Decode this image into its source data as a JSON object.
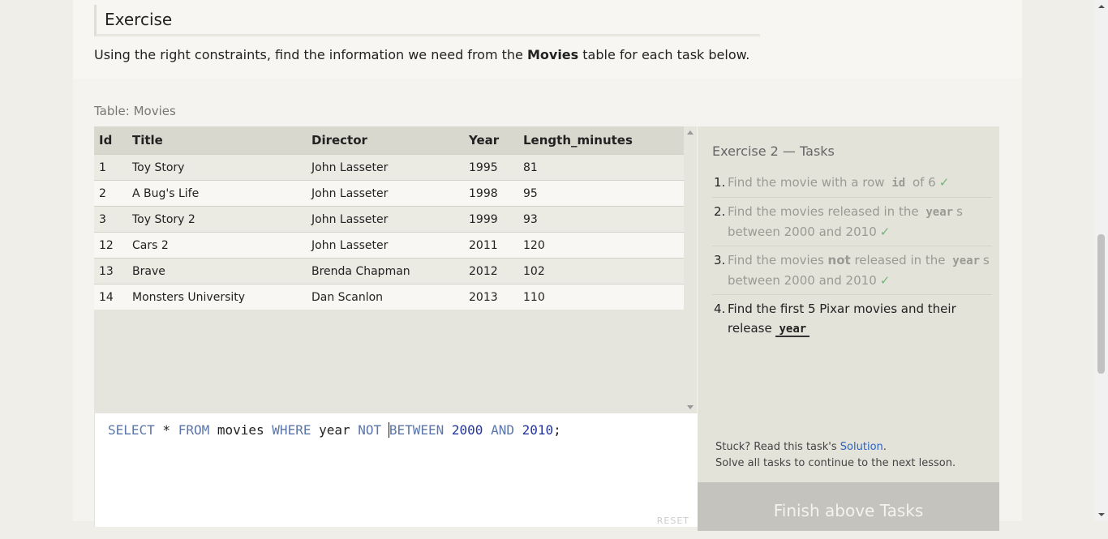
{
  "intro": {
    "heading": "Exercise",
    "text_before": "Using the right constraints, find the information we need from the ",
    "text_bold": "Movies",
    "text_after": " table for each task below."
  },
  "table": {
    "label": "Table: Movies",
    "columns": [
      "Id",
      "Title",
      "Director",
      "Year",
      "Length_minutes"
    ],
    "rows": [
      [
        "1",
        "Toy Story",
        "John Lasseter",
        "1995",
        "81"
      ],
      [
        "2",
        "A Bug's Life",
        "John Lasseter",
        "1998",
        "95"
      ],
      [
        "3",
        "Toy Story 2",
        "John Lasseter",
        "1999",
        "93"
      ],
      [
        "12",
        "Cars 2",
        "John Lasseter",
        "2011",
        "120"
      ],
      [
        "13",
        "Brave",
        "Brenda Chapman",
        "2012",
        "102"
      ],
      [
        "14",
        "Monsters University",
        "Dan Scanlon",
        "2013",
        "110"
      ]
    ]
  },
  "editor": {
    "tokens": {
      "t1": "SELECT",
      "t2": " * ",
      "t3": "FROM",
      "t4": " movies ",
      "t5": "WHERE",
      "t6": " year ",
      "t7": "NOT",
      "t8": " ",
      "t9": "BETWEEN",
      "t10": " ",
      "t11": "2000",
      "t12": " ",
      "t13": "AND",
      "t14": " ",
      "t15": "2010",
      "t16": ";"
    },
    "reset_label": "RESET"
  },
  "tasks": {
    "title": "Exercise 2 — Tasks",
    "items": [
      {
        "num": "1.",
        "a": "Find the movie with a row ",
        "code": "id",
        "b": " of 6",
        "check": "✓"
      },
      {
        "num": "2.",
        "a": "Find the movies released in the ",
        "code": "year",
        "b": "s between 2000 and 2010",
        "check": "✓"
      },
      {
        "num": "3.",
        "a": "Find the movies ",
        "bold": "not",
        "a2": " released in the ",
        "code": "year",
        "b": "s between 2000 and 2010",
        "check": "✓"
      },
      {
        "num": "4.",
        "a": "Find the first 5 Pixar movies and their release ",
        "code": "year"
      }
    ],
    "stuck_prefix": "Stuck? Read this task's ",
    "solution_link": "Solution",
    "stuck_suffix": ".",
    "continue_text": "Solve all tasks to continue to the next lesson.",
    "finish_button": "Finish above Tasks"
  },
  "colors": {
    "keyword": "#5b75a8",
    "number": "#23349c",
    "check": "#72b47a",
    "link": "#2b63c4"
  }
}
